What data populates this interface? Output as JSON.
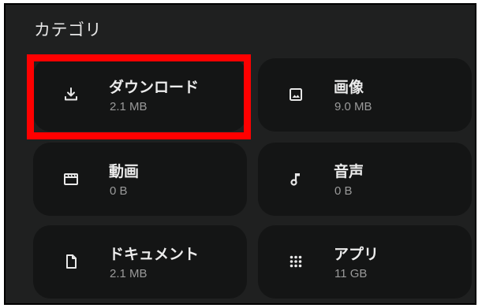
{
  "section": {
    "title": "カテゴリ"
  },
  "categories": [
    {
      "label": "ダウンロード",
      "size": "2.1 MB",
      "icon": "download-icon"
    },
    {
      "label": "画像",
      "size": "9.0 MB",
      "icon": "image-icon"
    },
    {
      "label": "動画",
      "size": "0 B",
      "icon": "video-icon"
    },
    {
      "label": "音声",
      "size": "0 B",
      "icon": "audio-icon"
    },
    {
      "label": "ドキュメント",
      "size": "2.1 MB",
      "icon": "document-icon"
    },
    {
      "label": "アプリ",
      "size": "11 GB",
      "icon": "apps-grid-icon"
    }
  ],
  "highlight": {
    "target": "ダウンロード",
    "color": "#ff0000"
  },
  "colors": {
    "background": "#1f2020",
    "tile": "#141515",
    "text_primary": "#ececec",
    "text_secondary": "#9a9a9a"
  }
}
